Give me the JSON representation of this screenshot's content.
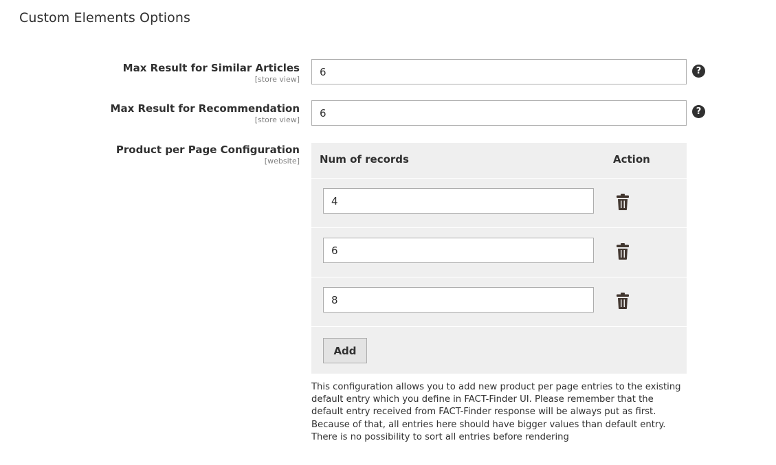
{
  "section": {
    "title": "Custom Elements Options"
  },
  "fields": {
    "similar_articles": {
      "label": "Max Result for Similar Articles",
      "scope": "[store view]",
      "value": "6",
      "help_icon": "question-circle-icon",
      "help_glyph": "?"
    },
    "recommendation": {
      "label": "Max Result for Recommendation",
      "scope": "[store view]",
      "value": "6",
      "help_icon": "question-circle-icon",
      "help_glyph": "?"
    },
    "product_per_page": {
      "label": "Product per Page Configuration",
      "scope": "[website]"
    }
  },
  "grid": {
    "columns": {
      "records": "Num of records",
      "action": "Action"
    },
    "rows": [
      {
        "value": "4",
        "action_icon": "trash-icon"
      },
      {
        "value": "6",
        "action_icon": "trash-icon"
      },
      {
        "value": "8",
        "action_icon": "trash-icon"
      }
    ],
    "add_label": "Add"
  },
  "note": "This configuration allows you to add new product per page entries to the existing default entry which you define in FACT-Finder UI. Please remember that the default entry received from FACT-Finder response will be always put as first. Because of that, all entries here should have bigger values than default entry. There is no possibility to sort all entries before rendering",
  "colors": {
    "text": "#303030",
    "scope": "#808080",
    "grid_bg": "#efefef",
    "input_border": "#adadad",
    "button_bg": "#e3e3e3"
  }
}
